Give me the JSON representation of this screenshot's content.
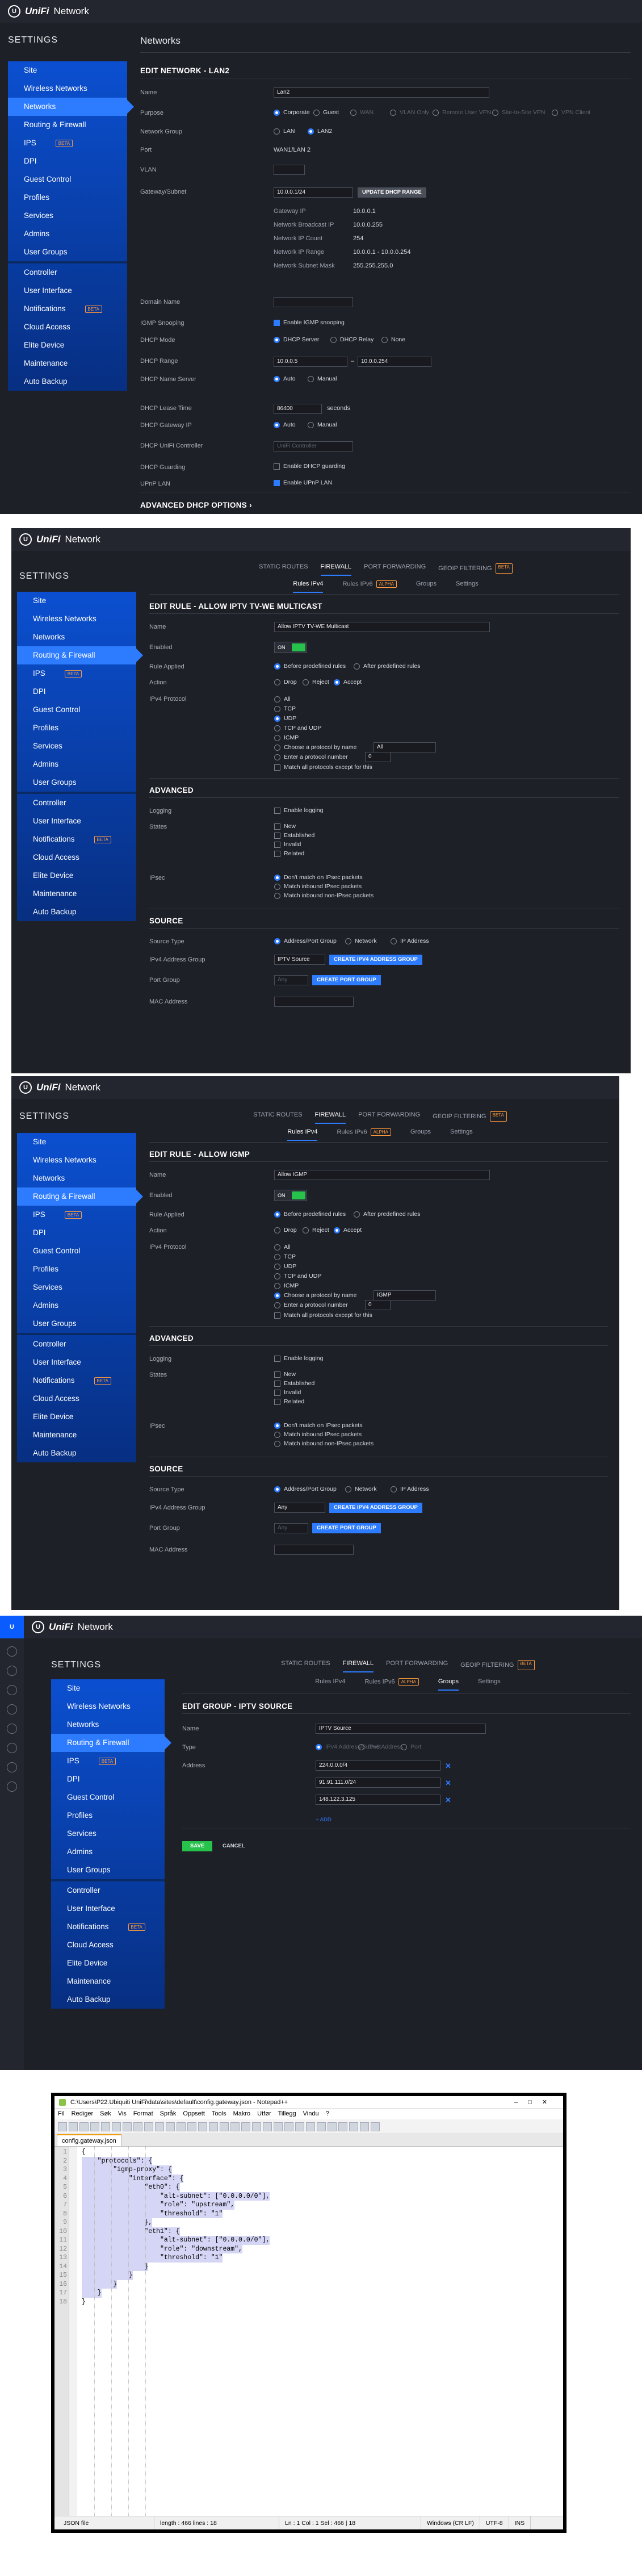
{
  "app": {
    "logo_text": "UniFi",
    "logo_suffix": "Network",
    "settings_title": "SETTINGS"
  },
  "nav": {
    "group1": [
      "Site",
      "Wireless Networks",
      "Networks",
      "Routing & Firewall",
      "IPS",
      "DPI",
      "Guest Control",
      "Profiles",
      "Services",
      "Admins",
      "User Groups"
    ],
    "group2": [
      "Controller",
      "User Interface",
      "Notifications",
      "Cloud Access",
      "Elite Device",
      "Maintenance",
      "Auto Backup"
    ],
    "beta_label": "BETA"
  },
  "tabs": {
    "static_routes": "STATIC ROUTES",
    "firewall": "FIREWALL",
    "port_forwarding": "PORT FORWARDING",
    "geoip": "GEOIP FILTERING",
    "beta": "BETA"
  },
  "subtabs": {
    "ipv4": "Rules IPv4",
    "ipv6": "Rules IPv6",
    "alpha": "ALPHA",
    "groups": "Groups",
    "settings": "Settings"
  },
  "s1": {
    "page_title": "Networks",
    "section": "EDIT NETWORK - LAN2",
    "labels": [
      "Name",
      "Purpose",
      "Network Group",
      "Port",
      "VLAN",
      "Gateway/Subnet",
      "Domain Name",
      "IGMP Snooping",
      "DHCP Mode",
      "DHCP Range",
      "DHCP Name Server",
      "DHCP Lease Time",
      "DHCP Gateway IP",
      "DHCP UniFi Controller",
      "DHCP Guarding",
      "UPnP LAN"
    ],
    "name_value": "Lan2",
    "purpose_options": [
      "Corporate",
      "Guest",
      "WAN",
      "VLAN Only",
      "Remote User VPN",
      "Site-to-Site VPN",
      "VPN Client"
    ],
    "group_options": [
      "LAN",
      "LAN2"
    ],
    "port_value": "WAN1/LAN 2",
    "gateway_value": "10.0.0.1/24",
    "update_dhcp_button": "UPDATE DHCP RANGE",
    "gw_rows": [
      [
        "Gateway IP",
        "10.0.0.1"
      ],
      [
        "Network Broadcast IP",
        "10.0.0.255"
      ],
      [
        "Network IP Count",
        "254"
      ],
      [
        "Network IP Range",
        "10.0.0.1 - 10.0.0.254"
      ],
      [
        "Network Subnet Mask",
        "255.255.255.0"
      ]
    ],
    "igmp_label": "Enable IGMP snooping",
    "dhcp_modes": [
      "DHCP Server",
      "DHCP Relay",
      "None"
    ],
    "range_start": "10.0.0.5",
    "range_end": "10.0.0.254",
    "name_server": [
      "Auto",
      "Manual"
    ],
    "lease_value": "86400",
    "lease_unit": "seconds",
    "gateway_ip": [
      "Auto",
      "Manual"
    ],
    "controller_ph": "UniFi Controller",
    "guarding_label": "Enable DHCP guarding",
    "upnp_label": "Enable UPnP LAN",
    "advanced": "ADVANCED DHCP OPTIONS"
  },
  "rule_common": {
    "labels": {
      "name": "Name",
      "enabled": "Enabled",
      "rule_applied": "Rule Applied",
      "action": "Action",
      "protocol": "IPv4 Protocol",
      "logging": "Logging",
      "states": "States",
      "ipsec": "IPsec",
      "source_type": "Source Type",
      "addr_group": "IPv4 Address Group",
      "port_group": "Port Group",
      "mac": "MAC Address"
    },
    "on": "ON",
    "applied": [
      "Before predefined rules",
      "After predefined rules"
    ],
    "actions": [
      "Drop",
      "Reject",
      "Accept"
    ],
    "protocols": [
      "All",
      "TCP",
      "UDP",
      "TCP and UDP",
      "ICMP",
      "Choose a protocol by name",
      "Enter a protocol number"
    ],
    "match_all": "Match all protocols except for this",
    "advanced": "ADVANCED",
    "enable_logging": "Enable logging",
    "states": [
      "New",
      "Established",
      "Invalid",
      "Related"
    ],
    "ipsec": [
      "Don't match on IPsec packets",
      "Match inbound IPsec packets",
      "Match inbound non-IPsec packets"
    ],
    "source": "SOURCE",
    "source_types": [
      "Address/Port Group",
      "Network",
      "IP Address"
    ],
    "create_addr_btn": "CREATE IPV4 ADDRESS GROUP",
    "create_port_btn": "CREATE PORT GROUP",
    "port_any": "Any",
    "proto_number": "0"
  },
  "s2": {
    "section": "EDIT RULE - ALLOW IPTV TV-WE MULTICAST",
    "name_value": "Allow IPTV TV-WE Multicast",
    "proto_name": "All",
    "addr_group": "IPTV Source"
  },
  "s3": {
    "section": "EDIT RULE - ALLOW IGMP",
    "name_value": "Allow IGMP",
    "proto_name": "IGMP",
    "addr_group": "Any"
  },
  "s4": {
    "section": "EDIT GROUP - IPTV SOURCE",
    "labels": {
      "name": "Name",
      "type": "Type",
      "address": "Address"
    },
    "name_value": "IPTV Source",
    "types": [
      "IPv4 Address/Subnet",
      "IPv6 Address",
      "Port"
    ],
    "addresses": [
      "224.0.0.0/4",
      "91.91.111.0/24",
      "148.122.3.125"
    ],
    "add": "+ ADD",
    "save": "SAVE",
    "cancel": "CANCEL"
  },
  "s5": {
    "title": "C:\\Users\\P22.Ubiquiti UniFi\\data\\sites\\default\\config.gateway.json - Notepad++",
    "menu": [
      "Fil",
      "Rediger",
      "Søk",
      "Vis",
      "Format",
      "Språk",
      "Oppsett",
      "Tools",
      "Makro",
      "Utfør",
      "Tillegg",
      "Vindu",
      "?"
    ],
    "file_tab": "config.gateway.json",
    "code": [
      "{",
      "    \"protocols\": {",
      "        \"igmp-proxy\": {",
      "            \"interface\": {",
      "                \"eth0\": {",
      "                    \"alt-subnet\": [\"0.0.0.0/0\"],",
      "                    \"role\": \"upstream\",",
      "                    \"threshold\": \"1\"",
      "                },",
      "                \"eth1\": {",
      "                    \"alt-subnet\": [\"0.0.0.0/0\"],",
      "                    \"role\": \"downstream\",",
      "                    \"threshold\": \"1\"",
      "                }",
      "            }",
      "        }",
      "    }",
      "}"
    ],
    "status": [
      "JSON file",
      "length : 466   lines : 18",
      "Ln : 1   Col : 1   Sel : 466 | 18",
      "Windows (CR LF)",
      "UTF-8",
      "INS"
    ]
  }
}
